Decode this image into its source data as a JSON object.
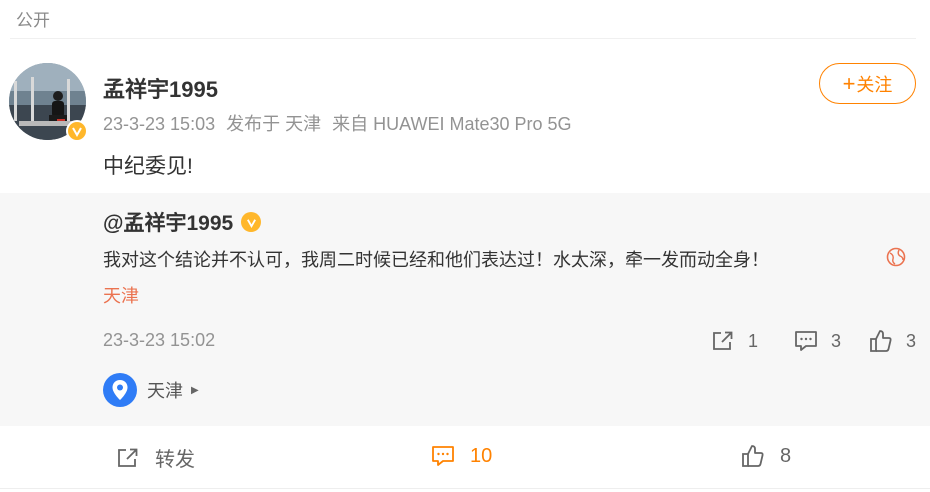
{
  "visibility_label": "公开",
  "post": {
    "author_name": "孟祥宇1995",
    "time": "23-3-23 15:03",
    "published_at": "发布于 天津",
    "source": "来自 HUAWEI Mate30 Pro 5G",
    "text": "中纪委见!",
    "follow_label": "关注",
    "follow_plus": "+"
  },
  "repost": {
    "author": "@孟祥宇1995",
    "text": "我对这个结论并不认可，我周二时候已经和他们表达过！水太深，牵一发而动全身！",
    "location": "天津",
    "time": "23-3-23 15:02",
    "share_count": "1",
    "comment_count": "3",
    "like_count": "3",
    "location_tag": "天津"
  },
  "actions": {
    "repost_label": "转发",
    "comment_count": "10",
    "like_count": "8"
  },
  "colors": {
    "accent": "#ff8200",
    "verified": "#ffb72b",
    "location_link": "#eb7350",
    "pin_blue": "#2f7cf6"
  }
}
